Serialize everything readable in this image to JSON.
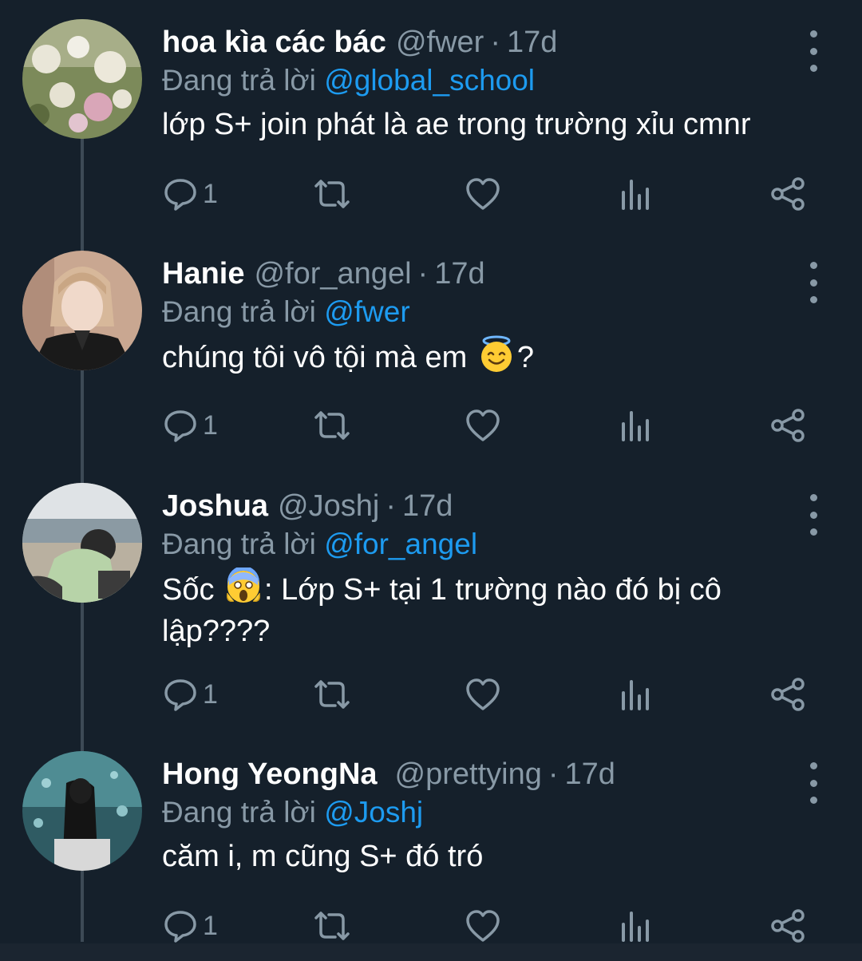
{
  "thread": {
    "reply_prefix": "Đang trả lời",
    "tweets": [
      {
        "name": "hoa kìa các bác",
        "handle": "@fwer",
        "time": "17d",
        "reply_to": "@global_school",
        "text_before": "lớp S+ join phát là ae trong trường xỉu cmnr",
        "emoji": "",
        "text_after": "",
        "reply_count": "1",
        "avatar_icon": "flower-photo"
      },
      {
        "name": "Hanie",
        "handle": "@for_angel",
        "time": "17d",
        "reply_to": "@fwer",
        "text_before": "chúng tôi vô tội mà em ",
        "emoji": "halo-smile-emoji",
        "text_after": "?",
        "reply_count": "1",
        "avatar_icon": "portrait-photo"
      },
      {
        "name": "Joshua",
        "handle": "@Joshj",
        "time": "17d",
        "reply_to": "@for_angel",
        "text_before": "Sốc ",
        "emoji": "scream-emoji",
        "text_after": ": Lớp S+ tại 1 trường nào đó bị cô lập????",
        "reply_count": "1",
        "avatar_icon": "beach-photo"
      },
      {
        "name": "Hong YeongNa",
        "handle": "@prettying",
        "time": "17d",
        "reply_to": "@Joshj",
        "text_before": "căm i, m cũng S+ đó tró",
        "emoji": "",
        "text_after": "",
        "reply_count": "1",
        "avatar_icon": "aquarium-photo"
      }
    ]
  },
  "colors": {
    "background": "#15202b",
    "text": "#ffffff",
    "muted": "#8899a6",
    "mention": "#1d9bf0",
    "thread_line": "#3d4a56"
  }
}
